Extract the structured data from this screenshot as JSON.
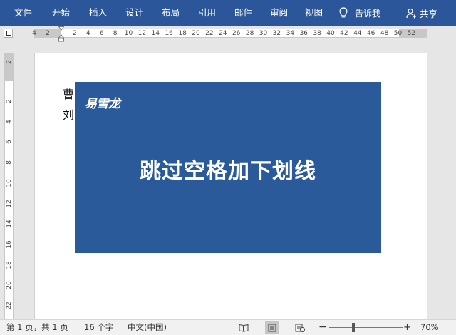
{
  "ribbon": {
    "tabs": [
      {
        "label": "文件",
        "name": "tab-file"
      },
      {
        "label": "开始",
        "name": "tab-home"
      },
      {
        "label": "插入",
        "name": "tab-insert"
      },
      {
        "label": "设计",
        "name": "tab-design"
      },
      {
        "label": "布局",
        "name": "tab-layout"
      },
      {
        "label": "引用",
        "name": "tab-references"
      },
      {
        "label": "邮件",
        "name": "tab-mailings"
      },
      {
        "label": "审阅",
        "name": "tab-review"
      },
      {
        "label": "视图",
        "name": "tab-view"
      }
    ],
    "tell_me": "告诉我",
    "share": "共享",
    "accent": "#2b579a"
  },
  "hruler": {
    "labels": [
      "4",
      "2",
      "2",
      "4",
      "6",
      "8",
      "10",
      "12",
      "14",
      "16",
      "18",
      "20",
      "22",
      "24",
      "26",
      "28",
      "30",
      "32",
      "34",
      "36",
      "38",
      "40",
      "42",
      "44",
      "46",
      "48",
      "50",
      "52"
    ]
  },
  "vruler": {
    "labels": [
      "2",
      "2",
      "4",
      "6",
      "8",
      "10",
      "12",
      "14",
      "16",
      "18",
      "20",
      "22"
    ]
  },
  "document": {
    "lines": [
      "曹",
      "刘"
    ]
  },
  "banner": {
    "brand": "易雪龙",
    "headline": "跳过空格加下划线",
    "color": "#2a5a9a"
  },
  "status": {
    "page": "第 1 页，共 1 页",
    "words": "16 个字",
    "language": "中文(中国)",
    "zoom": "70%",
    "zoom_minus": "−",
    "zoom_plus": "+"
  },
  "icons": [
    "lightbulb-icon",
    "person-add-icon",
    "read-mode-icon",
    "print-layout-icon",
    "web-layout-icon"
  ]
}
